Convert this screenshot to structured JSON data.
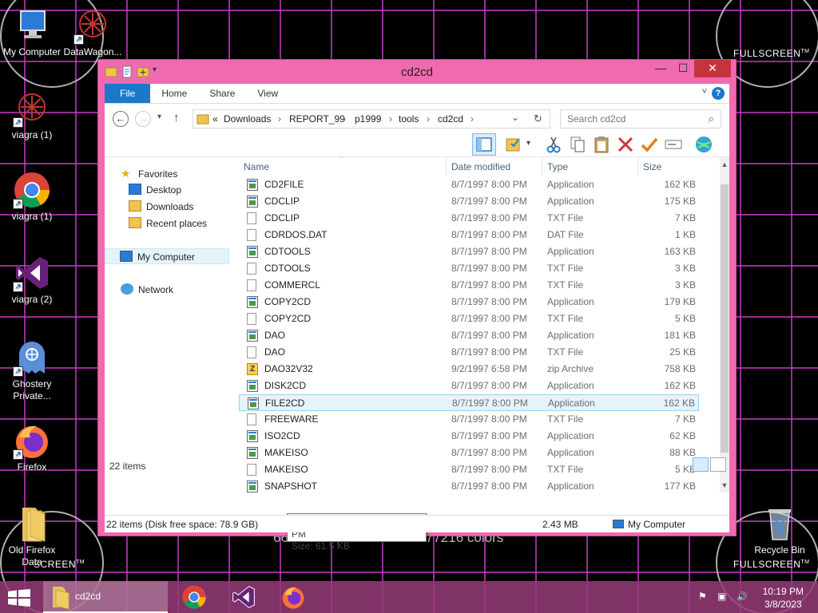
{
  "desktop": {
    "icons": [
      {
        "label": "My Computer"
      },
      {
        "label": "DataWagon..."
      },
      {
        "label": "viagra (1)"
      },
      {
        "label": "viagra (1)"
      },
      {
        "label": "viagra (2)"
      },
      {
        "label": "Ghostery Private..."
      },
      {
        "label": "Firefox"
      },
      {
        "label": "Old Firefox Data"
      },
      {
        "label": "Recycle Bin"
      }
    ],
    "fullscreen_marks": [
      "FULLSCREEN",
      "SCREEN",
      "FULLSCREEN"
    ],
    "trademark": "TM",
    "caption": "666 x 666 pixels with 16777216 colors"
  },
  "window": {
    "title": "cd2cd",
    "controls": {
      "minimize": "—",
      "maximize": "☐",
      "close": "✕"
    },
    "ribbon_tabs": [
      "File",
      "Home",
      "Share",
      "View"
    ],
    "help_label": "?",
    "ribbon_collapse": "˅",
    "nav": {
      "back": "←",
      "forward": "→",
      "recent": "▾",
      "up": "↑"
    },
    "breadcrumb": {
      "overflow": "«",
      "parts": [
        "Downloads",
        "REPORT_99",
        "p1999",
        "tools",
        "cd2cd"
      ],
      "separator": "›"
    },
    "address_controls": {
      "dropdown": "⌄",
      "refresh": "↻"
    },
    "search": {
      "placeholder": "Search cd2cd",
      "icon": "⌕"
    },
    "nav_pane": {
      "favorites": "Favorites",
      "fav_items": [
        "Desktop",
        "Downloads",
        "Recent places"
      ],
      "computer": "My Computer",
      "network": "Network"
    },
    "columns": [
      "Name",
      "Date modified",
      "Type",
      "Size"
    ],
    "sort_indicator": "^",
    "files": [
      {
        "name": "CD2FILE",
        "date": "8/7/1997 8:00 PM",
        "type": "Application",
        "size": "162 KB",
        "kind": "app"
      },
      {
        "name": "CDCLIP",
        "date": "8/7/1997 8:00 PM",
        "type": "Application",
        "size": "175 KB",
        "kind": "app"
      },
      {
        "name": "CDCLIP",
        "date": "8/7/1997 8:00 PM",
        "type": "TXT File",
        "size": "7 KB",
        "kind": "txt"
      },
      {
        "name": "CDRDOS.DAT",
        "date": "8/7/1997 8:00 PM",
        "type": "DAT File",
        "size": "1 KB",
        "kind": "dat"
      },
      {
        "name": "CDTOOLS",
        "date": "8/7/1997 8:00 PM",
        "type": "Application",
        "size": "163 KB",
        "kind": "app"
      },
      {
        "name": "CDTOOLS",
        "date": "8/7/1997 8:00 PM",
        "type": "TXT File",
        "size": "3 KB",
        "kind": "txt"
      },
      {
        "name": "COMMERCL",
        "date": "8/7/1997 8:00 PM",
        "type": "TXT File",
        "size": "3 KB",
        "kind": "txt"
      },
      {
        "name": "COPY2CD",
        "date": "8/7/1997 8:00 PM",
        "type": "Application",
        "size": "179 KB",
        "kind": "app"
      },
      {
        "name": "COPY2CD",
        "date": "8/7/1997 8:00 PM",
        "type": "TXT File",
        "size": "5 KB",
        "kind": "txt"
      },
      {
        "name": "DAO",
        "date": "8/7/1997 8:00 PM",
        "type": "Application",
        "size": "181 KB",
        "kind": "app"
      },
      {
        "name": "DAO",
        "date": "8/7/1997 8:00 PM",
        "type": "TXT File",
        "size": "25 KB",
        "kind": "txt"
      },
      {
        "name": "DAO32V32",
        "date": "9/2/1997 6:58 PM",
        "type": "zip Archive",
        "size": "758 KB",
        "kind": "zip"
      },
      {
        "name": "DISK2CD",
        "date": "8/7/1997 8:00 PM",
        "type": "Application",
        "size": "162 KB",
        "kind": "app"
      },
      {
        "name": "FILE2CD",
        "date": "8/7/1997 8:00 PM",
        "type": "Application",
        "size": "162 KB",
        "kind": "app",
        "selected": true
      },
      {
        "name": "FREEWARE",
        "date": "8/7/1997 8:00 PM",
        "type": "TXT File",
        "size": "7 KB",
        "kind": "txt"
      },
      {
        "name": "ISO2CD",
        "date": "8/7/1997 8:00 PM",
        "type": "Application",
        "size": "62 KB",
        "kind": "app"
      },
      {
        "name": "MAKEISO",
        "date": "8/7/1997 8:00 PM",
        "type": "Application",
        "size": "88 KB",
        "kind": "app"
      },
      {
        "name": "MAKEISO",
        "date": "8/7/1997 8:00 PM",
        "type": "TXT File",
        "size": "5 KB",
        "kind": "txt"
      },
      {
        "name": "SNAPSHOT",
        "date": "8/7/1997 8:00 PM",
        "type": "Application",
        "size": "177 KB",
        "kind": "app"
      }
    ],
    "tooltip": {
      "line1": "Date created: 3/8/2023 9:48 PM",
      "line2": "Size: 61.5 KB"
    },
    "item_count": "22 items",
    "status": {
      "left": "22 items (Disk free space: 78.9 GB)",
      "size": "2.43 MB",
      "location": "My Computer"
    },
    "scroll": {
      "up": "▲",
      "down": "▼"
    }
  },
  "taskbar": {
    "active_label": "cd2cd",
    "clock_time": "10:19 PM",
    "clock_date": "3/8/2023",
    "tray": {
      "flag": "⚑",
      "network": "▣",
      "volume": "🔊"
    }
  },
  "colors": {
    "window_frame": "#f06ab0",
    "accent": "#1979ca",
    "selection": "#e5f3fb"
  }
}
